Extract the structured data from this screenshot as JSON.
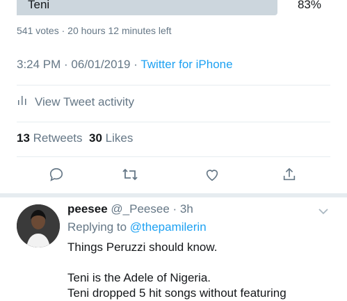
{
  "poll": {
    "option_label": "Teni",
    "option_percent": "83%",
    "option_fraction": 0.83,
    "meta": "541 votes · 20 hours 12 minutes left"
  },
  "tweet": {
    "time_date": "3:24 PM · 06/01/2019 · ",
    "source": "Twitter for iPhone",
    "activity_label": "View Tweet activity",
    "retweet_count": "13",
    "retweet_label": "Retweets",
    "like_count": "30",
    "like_label": "Likes"
  },
  "actions": {
    "icons": [
      "reply-icon",
      "retweet-icon",
      "like-icon",
      "share-icon"
    ]
  },
  "reply": {
    "name": "peesee",
    "handle_time": "@_Peesee · 3h",
    "replying_prefix": "Replying to ",
    "replying_to": "@thepamilerin",
    "text": "Things Peruzzi should know.\n\nTeni is the Adele of Nigeria.\nTeni dropped 5 hit songs without featuring"
  },
  "colors": {
    "accent": "#1da1f2",
    "muted": "#657786",
    "text": "#14171a",
    "poll_bar": "#ccd6dd",
    "divider": "#e6ecf0"
  }
}
